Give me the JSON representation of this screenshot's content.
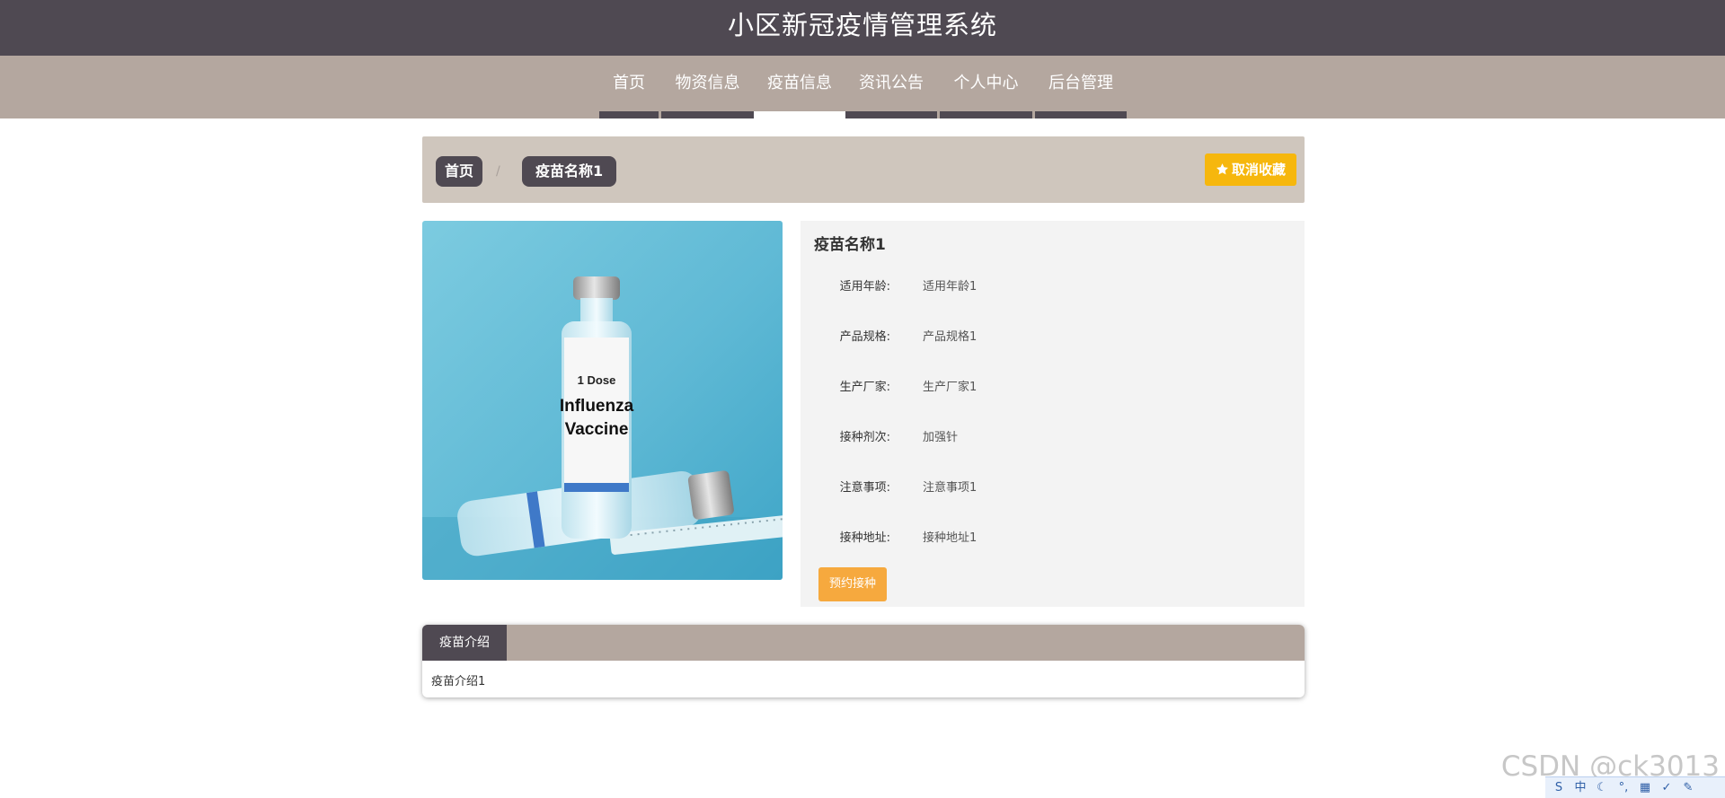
{
  "header": {
    "title": "小区新冠疫情管理系统"
  },
  "nav": {
    "items": [
      {
        "label": "首页"
      },
      {
        "label": "物资信息"
      },
      {
        "label": "疫苗信息"
      },
      {
        "label": "资讯公告"
      },
      {
        "label": "个人中心"
      },
      {
        "label": "后台管理"
      }
    ],
    "active_index": 2
  },
  "breadcrumb": {
    "home": "首页",
    "separator": "/",
    "current": "疫苗名称1"
  },
  "favorite_button": {
    "label": "取消收藏",
    "icon": "star-icon"
  },
  "product_image": {
    "cap_text": "1 Dose",
    "label_line1": "Influenza",
    "label_line2": "Vaccine"
  },
  "details": {
    "title": "疫苗名称1",
    "rows": [
      {
        "label": "适用年龄:",
        "value": "适用年龄1"
      },
      {
        "label": "产品规格:",
        "value": "产品规格1"
      },
      {
        "label": "生产厂家:",
        "value": "生产厂家1"
      },
      {
        "label": "接种剂次:",
        "value": "加强针"
      },
      {
        "label": "注意事项:",
        "value": "注意事项1"
      },
      {
        "label": "接种地址:",
        "value": "接种地址1"
      }
    ],
    "book_button": "预约接种"
  },
  "tabs": {
    "active_label": "疫苗介绍",
    "content": "疫苗介绍1"
  },
  "watermark": "CSDN @ck3013",
  "ime": {
    "items": [
      "S",
      "中",
      "☾",
      "°,",
      "▦",
      "✓",
      "✎"
    ]
  },
  "colors": {
    "dark": "#4f4952",
    "taupe": "#b4a79f",
    "beige": "#cfc6bd",
    "accent_yellow": "#f6b70d",
    "accent_orange": "#f6a93e"
  }
}
